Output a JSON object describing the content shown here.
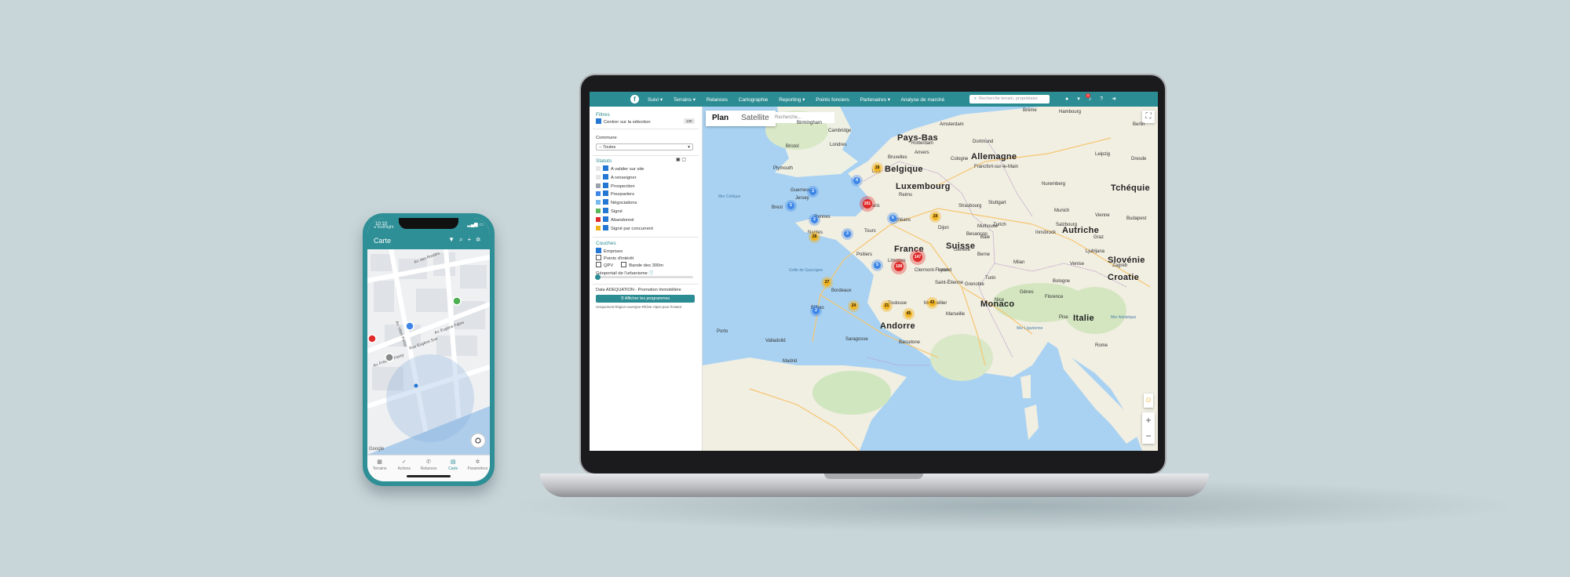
{
  "phone": {
    "status_time": "10:10",
    "back_label": "◂ TestFlight",
    "title": "Carte",
    "tabs": [
      {
        "label": "Terrains",
        "icon": "grid-icon"
      },
      {
        "label": "Actions",
        "icon": "check-icon"
      },
      {
        "label": "Relances",
        "icon": "phone-icon"
      },
      {
        "label": "Carte",
        "icon": "map-icon"
      },
      {
        "label": "Paramètres",
        "icon": "gear-icon"
      }
    ],
    "map_streets": [
      "Av. des Rosiers",
      "Rue Eugène Sue",
      "Av. Frédéric Passy",
      "Av. Eugène Fabre",
      "Av. Vitter Passy"
    ],
    "google": "Google"
  },
  "app": {
    "nav": [
      "Suivi ▾",
      "Terrains ▾",
      "Relances",
      "Cartographie",
      "Reporting ▾",
      "Points fonciers",
      "Partenaires ▾",
      "Analyse de marché"
    ],
    "search_placeholder": "Recherche terrain, propriétaire",
    "notif_count": "9",
    "sidebar": {
      "filtres_title": "Filtres",
      "centrer_label": "Centrer sur la sélection",
      "centrer_badge": "130",
      "commune_label": "Commune",
      "commune_value": "-- Toutes",
      "statuts_title": "Statuts",
      "statuts": [
        {
          "label": "A valider sur site",
          "color": "#e6e6e6"
        },
        {
          "label": "A renseigner",
          "color": "#e6e6e6"
        },
        {
          "label": "Prospection",
          "color": "#9aa3ad"
        },
        {
          "label": "Pourparlers",
          "color": "#3d86e8"
        },
        {
          "label": "Négociations",
          "color": "#79b8ef"
        },
        {
          "label": "Signé",
          "color": "#5cb85c"
        },
        {
          "label": "Abandonné",
          "color": "#e02a2a"
        },
        {
          "label": "Signé par concurrent",
          "color": "#f2b21c"
        }
      ],
      "couches_title": "Couches",
      "couches": [
        {
          "label": "Emprises",
          "checked": true
        },
        {
          "label": "Points d'intérêt",
          "checked": false
        }
      ],
      "qpv_label": "QPV",
      "bande_label": "Bande des 300m",
      "geoportail_label": "Géoportail de l'urbanisme",
      "data_label": "Data ADEQUATION - Promotion Immobilière",
      "afficher_label": "Afficher les programmes",
      "footnote": "Uniquement Région Auvergne-Rhône-Alpes pour l'instant"
    },
    "map": {
      "type_plan": "Plan",
      "type_satellite": "Satellite",
      "search_placeholder": "Recherche...",
      "countries": [
        "Pays-Bas",
        "Belgique",
        "Luxembourg",
        "Allemagne",
        "Tchéquie",
        "France",
        "Suisse",
        "Autriche",
        "Slovénie",
        "Croatie",
        "Italie",
        "Monaco",
        "Andorre"
      ],
      "cities": [
        "Brême",
        "Hambourg",
        "Amsterdam",
        "Berlin",
        "Leipzig",
        "Dresde",
        "Birmingham",
        "Cambridge",
        "Londres",
        "Bristol",
        "Rotterdam",
        "Anvers",
        "Dortmund",
        "Cologne",
        "Francfort-sur-le-Main",
        "Bruxelles",
        "Lille",
        "Plymouth",
        "Guernesey",
        "Jersey",
        "Brest",
        "Rennes",
        "Nantes",
        "Paris",
        "Reims",
        "Strasbourg",
        "Stuttgart",
        "Munich",
        "Nuremberg",
        "Zurich",
        "Genève",
        "Lyon",
        "Milan",
        "Turin",
        "Venise",
        "Bologne",
        "Florence",
        "Gênes",
        "Bordeaux",
        "Toulouse",
        "Montpellier",
        "Marseille",
        "Nice",
        "Bilbao",
        "Saragosse",
        "Barcelone",
        "Porto",
        "Valladolid",
        "Madrid",
        "Ljubljana",
        "Zagreb",
        "Budapest",
        "Vienne",
        "Graz",
        "Rome",
        "Pise",
        "Clermont-Ferrand",
        "Limoges",
        "Poitiers",
        "Tours",
        "Orléans",
        "Dijon",
        "Besançon",
        "Grenoble",
        "Saint-Étienne",
        "Salzbourg",
        "Innsbruck",
        "Bâle",
        "Berne",
        "Mulhouse"
      ],
      "seas": [
        "Mer Celtique",
        "Golfe de Gascogne",
        "Mer Ligurienne",
        "Mer Adriatique"
      ],
      "clusters": [
        {
          "count": "4",
          "type": "blue"
        },
        {
          "count": "3",
          "type": "blue"
        },
        {
          "count": "5",
          "type": "blue"
        },
        {
          "count": "2",
          "type": "blue"
        },
        {
          "count": "6",
          "type": "blue"
        },
        {
          "count": "3",
          "type": "blue"
        },
        {
          "count": "5",
          "type": "blue"
        },
        {
          "count": "2",
          "type": "blue"
        },
        {
          "count": "18",
          "type": "yellow"
        },
        {
          "count": "19",
          "type": "yellow"
        },
        {
          "count": "28",
          "type": "yellow"
        },
        {
          "count": "27",
          "type": "yellow"
        },
        {
          "count": "24",
          "type": "yellow"
        },
        {
          "count": "21",
          "type": "yellow"
        },
        {
          "count": "45",
          "type": "yellow"
        },
        {
          "count": "43",
          "type": "yellow"
        },
        {
          "count": "201",
          "type": "red"
        },
        {
          "count": "108",
          "type": "red"
        },
        {
          "count": "147",
          "type": "red"
        }
      ]
    }
  }
}
